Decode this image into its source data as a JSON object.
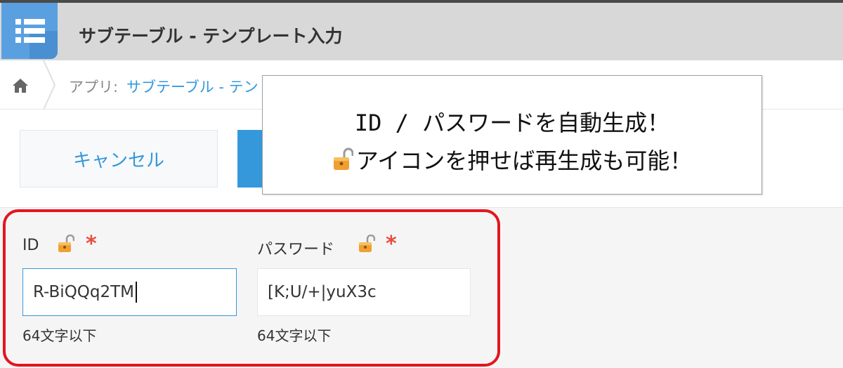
{
  "header": {
    "app_title": "サブテーブル - テンプレート入力",
    "app_icon": "list-icon"
  },
  "breadcrumb": {
    "home_icon": "home-icon",
    "prefix": "アプリ: ",
    "app_link": "サブテーブル - テン"
  },
  "toolbar": {
    "cancel_label": "キャンセル"
  },
  "callout": {
    "line1": "ID / パスワードを自動生成！",
    "line2": "アイコンを押せば再生成も可能！",
    "icon": "unlock-icon"
  },
  "form": {
    "id_field": {
      "label": "ID",
      "required_mark": "*",
      "value": "R-BiQQq2TM",
      "hint": "64文字以下",
      "icon": "unlock-icon"
    },
    "password_field": {
      "label": "パスワード",
      "required_mark": "*",
      "value": "[K;U/+|yuX3c",
      "hint": "64文字以下",
      "icon": "unlock-icon"
    }
  },
  "colors": {
    "accent": "#3498db",
    "header_bg": "#d8d8d8",
    "highlight_frame": "#e3161f",
    "required": "#e74c3c"
  }
}
